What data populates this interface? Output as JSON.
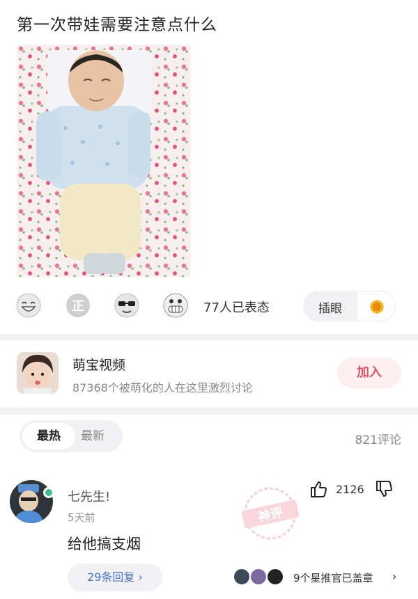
{
  "post": {
    "title": "第一次带娃需要注意点什么"
  },
  "reactions": {
    "icons": [
      "laughing-face",
      "zheng-badge",
      "sunglasses-face",
      "grinning-face"
    ],
    "count_text": "77人已表态",
    "chip_label": "插眼",
    "chip_icon": "sunflower"
  },
  "group": {
    "name": "萌宝视频",
    "description": "87368个被萌化的人在这里激烈讨论",
    "join_label": "加入"
  },
  "sort": {
    "hot_label": "最热",
    "new_label": "最新",
    "comment_count": "821评论"
  },
  "comment": {
    "username": "七先生!",
    "time": "5天前",
    "text": "给他搞支烟",
    "like_count": "2126",
    "reply_label": "29条回复 ›",
    "stamp_text": "神评",
    "stamped_by": "9个星推官已盖章",
    "chevron": "›"
  },
  "colors": {
    "accent_pink": "#e0566a",
    "link_blue": "#4a74c9",
    "online_green": "#3cc08a"
  }
}
